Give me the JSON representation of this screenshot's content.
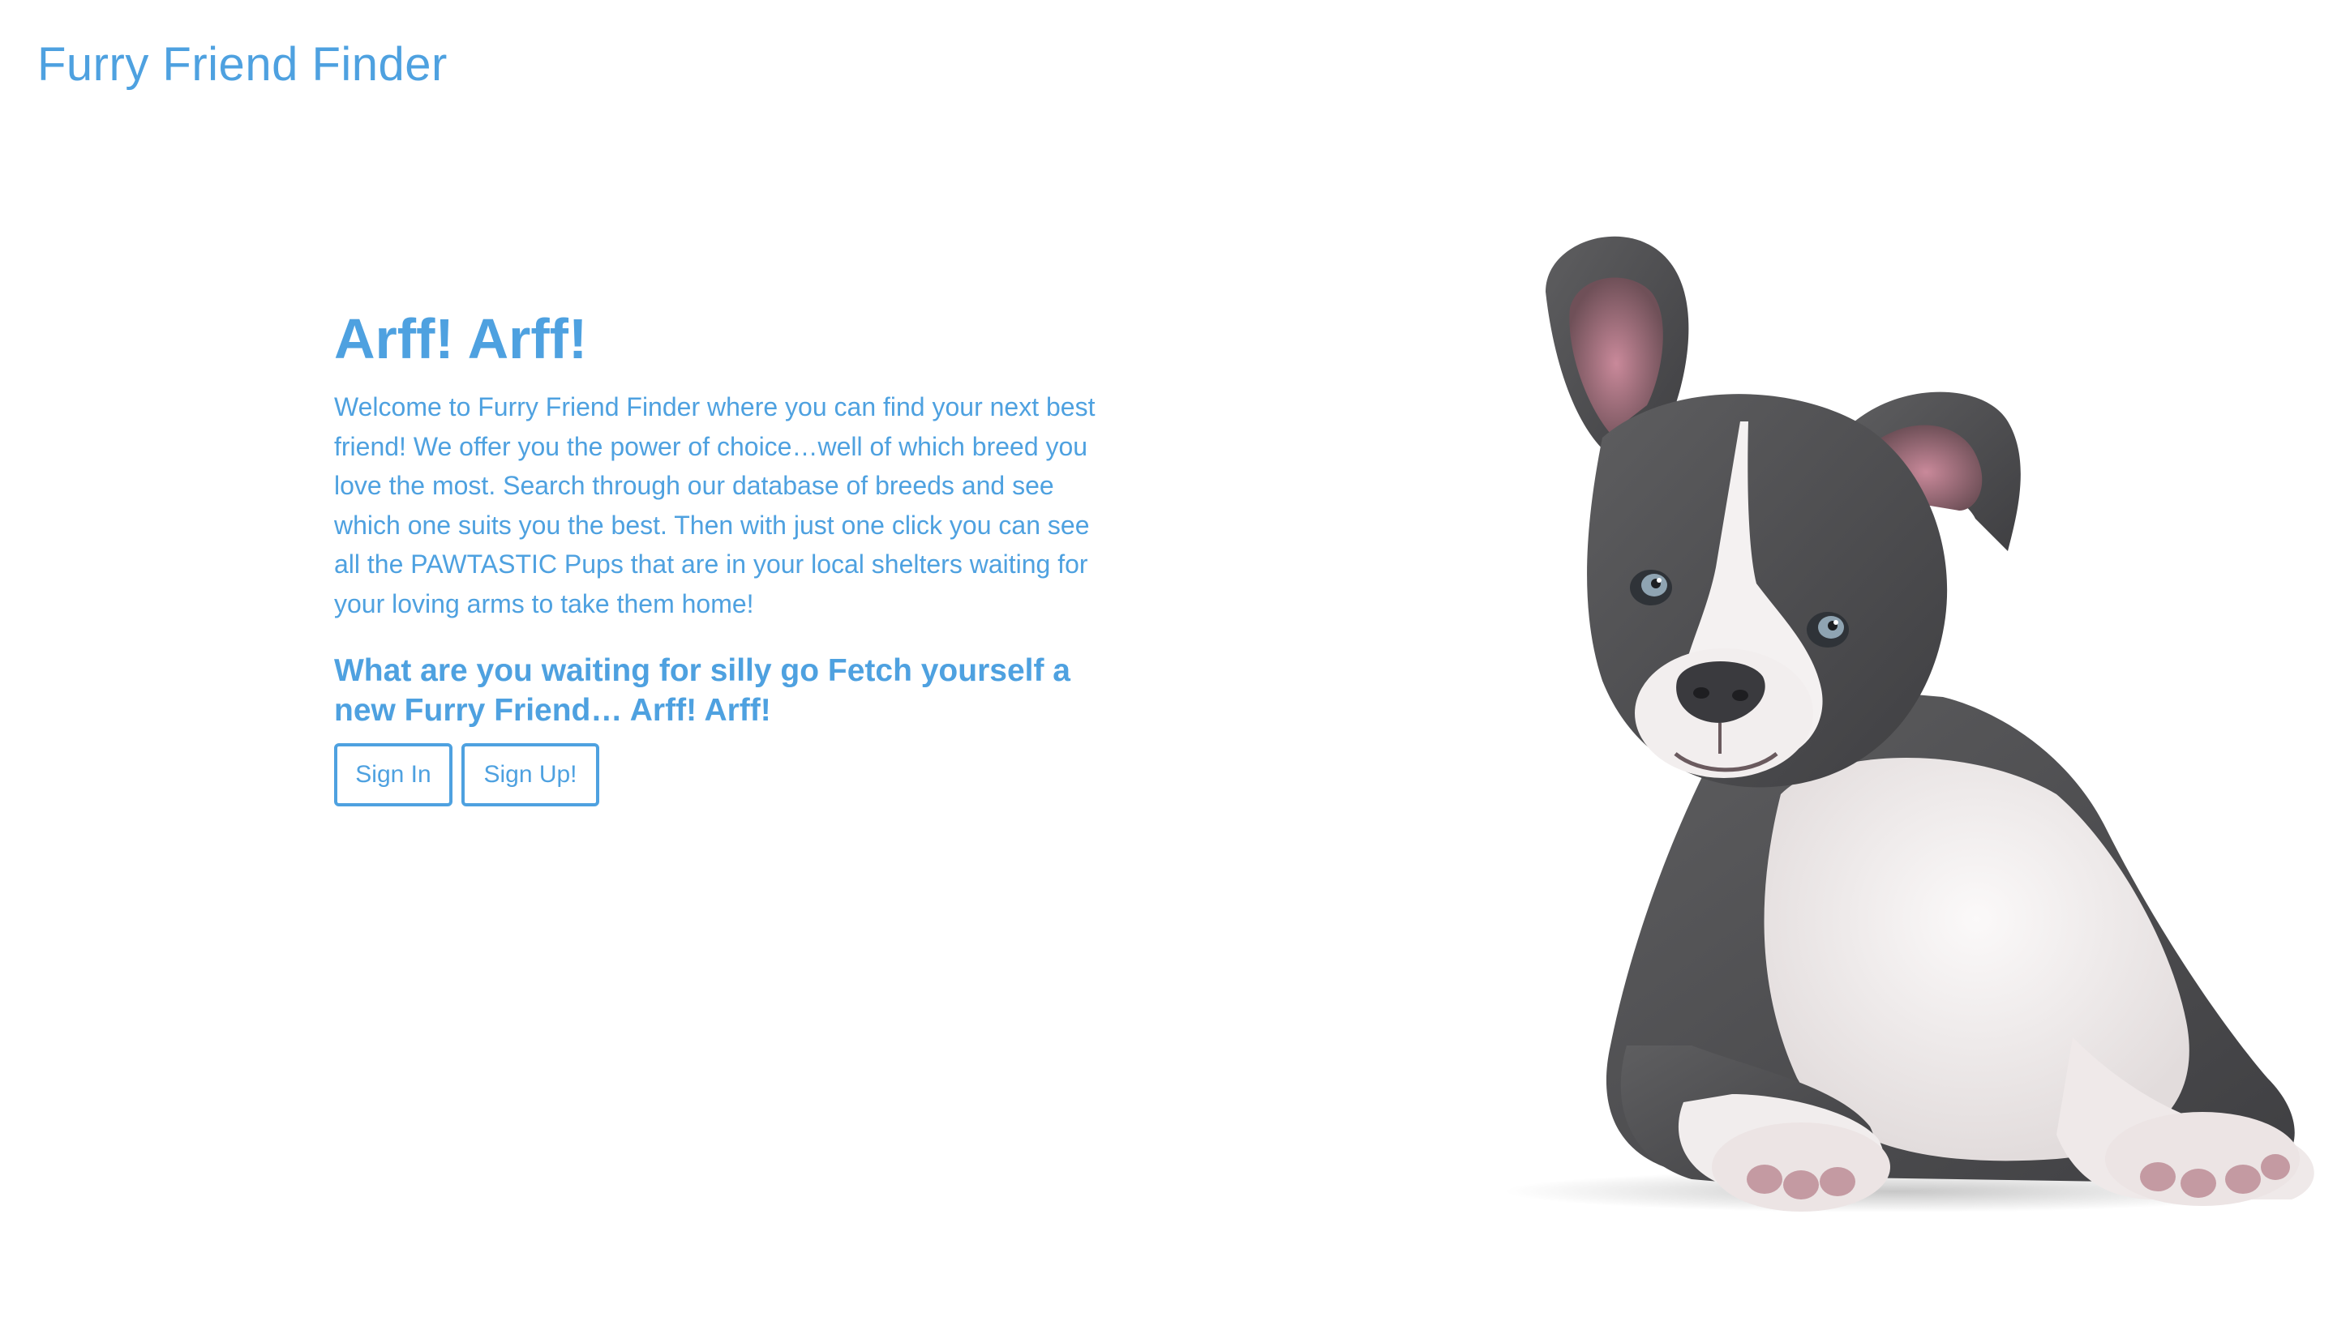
{
  "header": {
    "brand": "Furry Friend Finder"
  },
  "hero": {
    "title": "Arff! Arff!",
    "body": "Welcome to Furry Friend Finder where you can find your next best friend! We offer you the power of choice…well of which breed you love the most. Search through our database of breeds and see which one suits you the best. Then with just one click you can see all the PAWTASTIC Pups that are in your local shelters waiting for your loving arms to take them home!",
    "cta": "What are you waiting for silly go Fetch yourself a new Furry Friend… Arff! Arff!",
    "buttons": {
      "sign_in": "Sign In",
      "sign_up": "Sign Up!"
    }
  },
  "image": {
    "subject": "puppy-photo"
  },
  "colors": {
    "accent": "#4ea1e0",
    "background": "#ffffff"
  }
}
